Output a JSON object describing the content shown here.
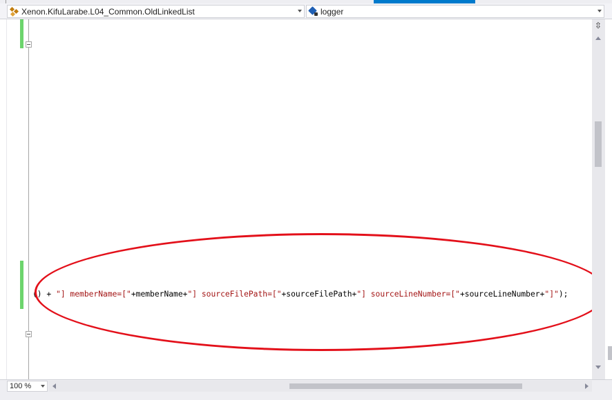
{
  "navbar": {
    "project_combo": {
      "label": "Xenon.KifuLarabe.L04_Common.OldLinkedList",
      "icon": "class-icon"
    },
    "member_combo": {
      "label": "logger",
      "icon": "private-field-icon"
    }
  },
  "editor": {
    "code_tokens": [
      {
        "text": "() + ",
        "kind": "op"
      },
      {
        "text": "\"] memberName=[\"",
        "kind": "str"
      },
      {
        "text": "+memberName+",
        "kind": "op"
      },
      {
        "text": "\"] sourceFilePath=[\"",
        "kind": "str"
      },
      {
        "text": "+sourceFilePath+",
        "kind": "op"
      },
      {
        "text": "\"] sourceLineNumber=[\"",
        "kind": "str"
      },
      {
        "text": "+sourceLineNumber+",
        "kind": "op"
      },
      {
        "text": "\"]\"",
        "kind": "str"
      },
      {
        "text": ");",
        "kind": "op"
      }
    ],
    "annotation": {
      "shape": "ellipse",
      "color": "#e3101a"
    }
  },
  "bottom": {
    "zoom_value": "100 %"
  },
  "colors": {
    "accent": "#007acc",
    "change_bar": "#6cd46c",
    "string_literal": "#a31515"
  }
}
